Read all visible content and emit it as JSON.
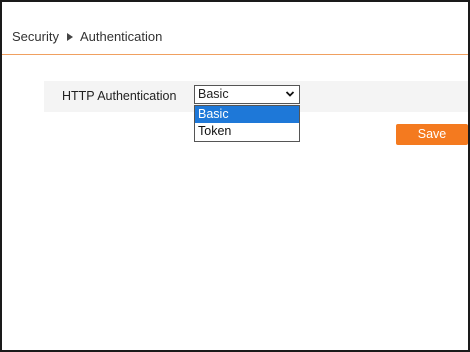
{
  "breadcrumb": {
    "section": "Security",
    "page": "Authentication"
  },
  "form": {
    "http_auth_label": "HTTP Authentication",
    "http_auth_value": "Basic",
    "options": [
      "Basic",
      "Token"
    ],
    "highlighted_option": "Basic"
  },
  "actions": {
    "save_label": "Save"
  },
  "colors": {
    "accent": "#f47a1f",
    "divider": "#f0a060",
    "selection": "#1e78d8"
  },
  "icons": {
    "breadcrumb_separator": "triangle-right-icon",
    "select_arrow": "chevron-down-icon"
  }
}
